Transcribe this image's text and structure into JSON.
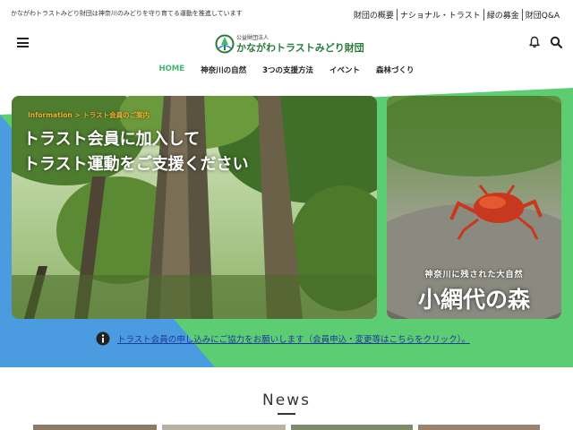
{
  "topbar": {
    "tagline": "かながわトラストみどり財団は神奈川のみどりを守り育てる運動を推進しています",
    "links": [
      "財団の概要",
      "ナショナル・トラスト",
      "緑の募金",
      "財団Q&A"
    ]
  },
  "header": {
    "logo_small": "公益財団法人",
    "logo_main": "かながわトラストみどり財団"
  },
  "nav": {
    "items": [
      "HOME",
      "神奈川の自然",
      "3つの支援方法",
      "イベント",
      "森林づくり"
    ],
    "active_index": 0
  },
  "hero": {
    "main": {
      "tag": "Information > トラスト会員のご案内",
      "line1": "トラスト会員に加入して",
      "line2": "トラスト運動をご支援ください"
    },
    "side": {
      "sub": "神奈川に残された大自然",
      "title": "小網代の森"
    }
  },
  "notice": {
    "text": "トラスト会員の申し込みにご協力をお願いします（会員申込・変更等はこちらをクリック）。"
  },
  "news": {
    "title": "News"
  },
  "colors": {
    "accent_green": "#3fb86a",
    "accent_blue": "#2f86d6",
    "tag_orange": "#f2b22e",
    "logo_green": "#2a7a3c",
    "notice_blue": "#1a3a9a"
  }
}
